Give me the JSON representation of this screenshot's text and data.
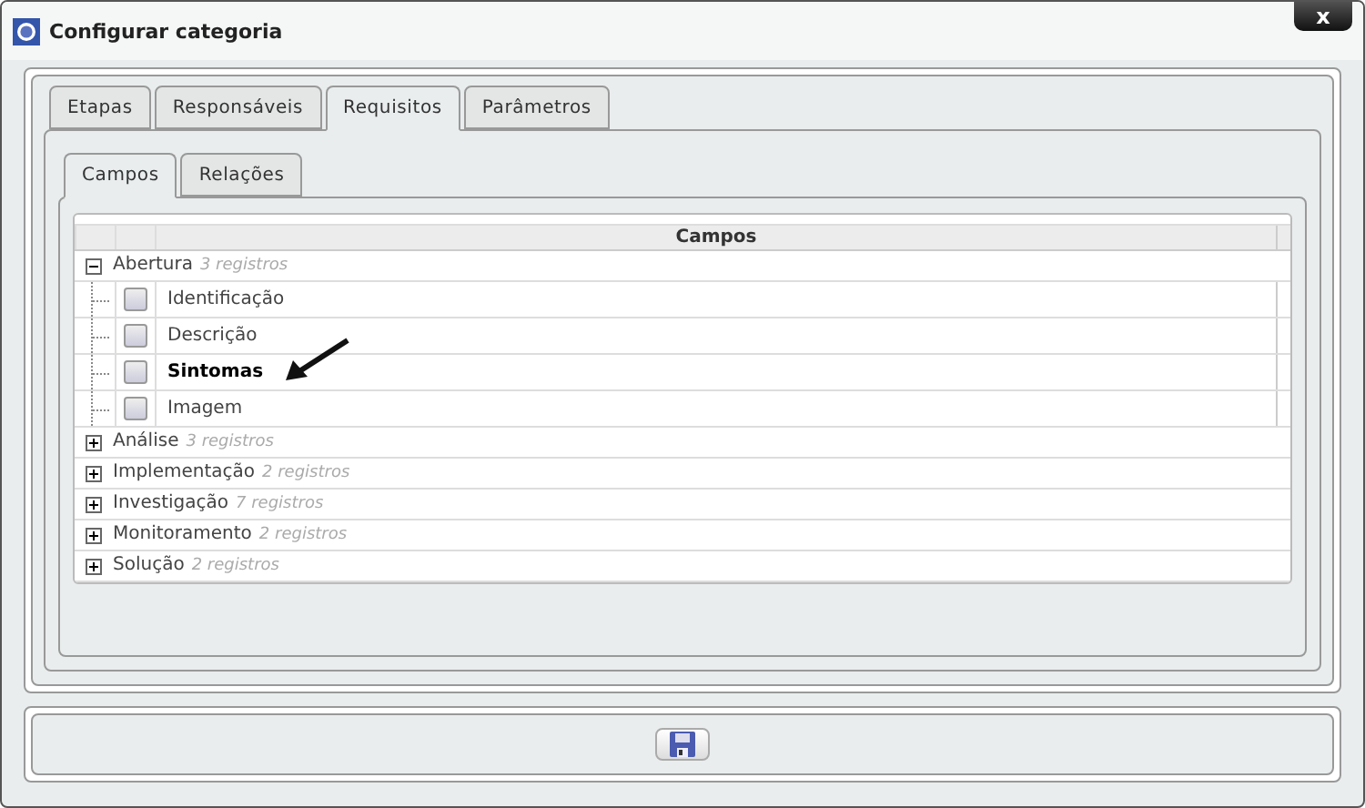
{
  "window": {
    "title": "Configurar categoria",
    "close": "x"
  },
  "tabs": [
    {
      "label": "Etapas",
      "selected": false
    },
    {
      "label": "Responsáveis",
      "selected": false
    },
    {
      "label": "Requisitos",
      "selected": true
    },
    {
      "label": "Parâmetros",
      "selected": false
    }
  ],
  "subtabs": [
    {
      "label": "Campos",
      "selected": true
    },
    {
      "label": "Relações",
      "selected": false
    }
  ],
  "grid": {
    "column": "Campos",
    "groups": [
      {
        "name": "Abertura",
        "count": "3 registros",
        "expanded": true,
        "children": [
          {
            "label": "Identificação",
            "checked": false,
            "highlighted": false
          },
          {
            "label": "Descrição",
            "checked": false,
            "highlighted": false
          },
          {
            "label": "Sintomas",
            "checked": false,
            "highlighted": true
          },
          {
            "label": "Imagem",
            "checked": false,
            "highlighted": false
          }
        ]
      },
      {
        "name": "Análise",
        "count": "3 registros",
        "expanded": false
      },
      {
        "name": "Implementação",
        "count": "2 registros",
        "expanded": false
      },
      {
        "name": "Investigação",
        "count": "7 registros",
        "expanded": false
      },
      {
        "name": "Monitoramento",
        "count": "2 registros",
        "expanded": false
      },
      {
        "name": "Solução",
        "count": "2 registros",
        "expanded": false
      }
    ]
  }
}
